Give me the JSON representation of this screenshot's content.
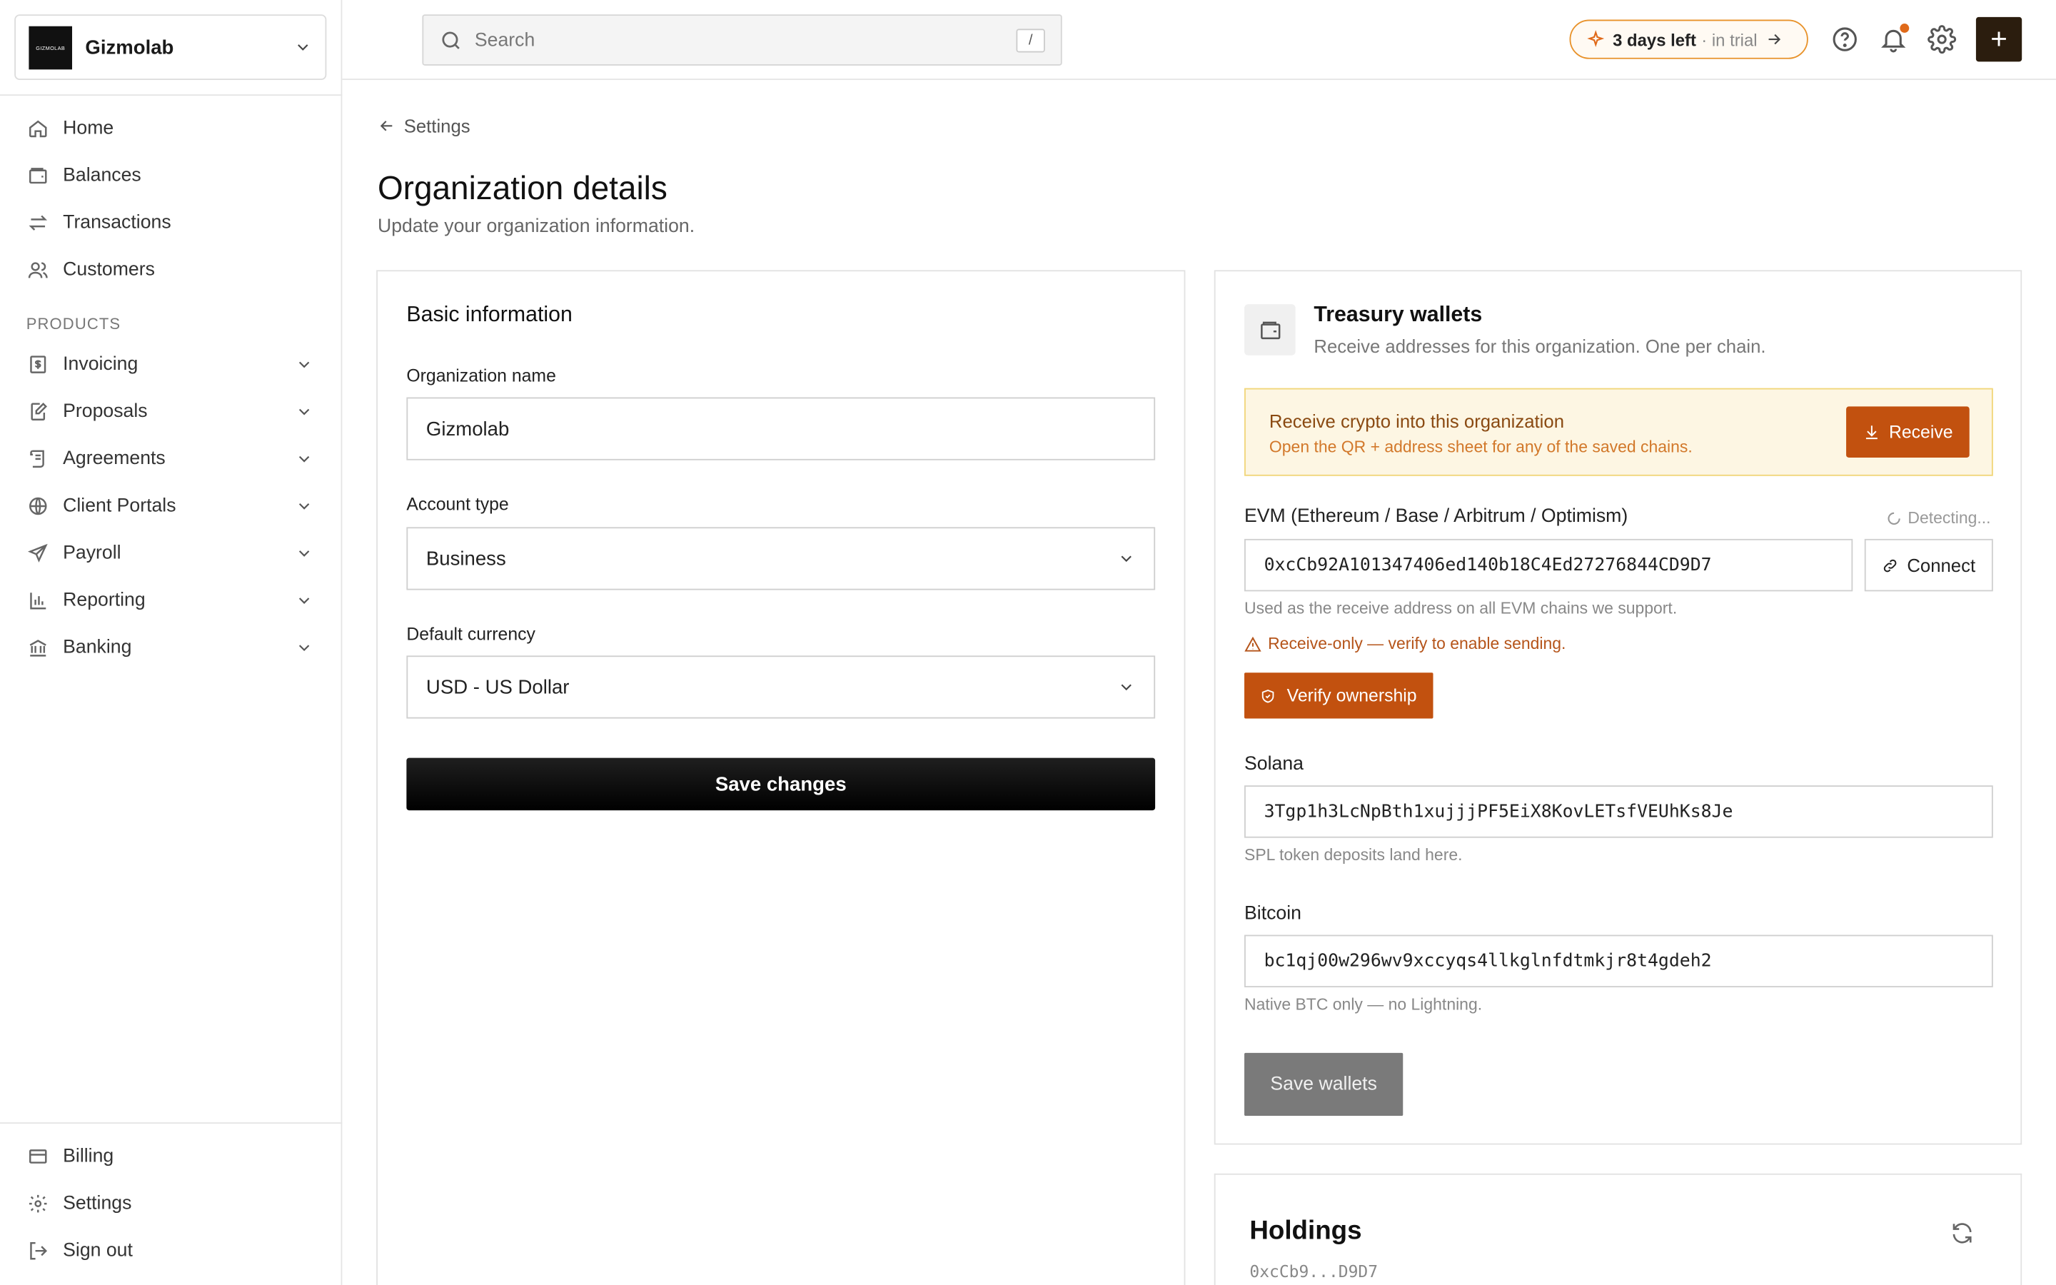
{
  "org": {
    "logo_text": "GIZMOLAB",
    "name": "Gizmolab"
  },
  "sidebar": {
    "main_items": [
      {
        "label": "Home",
        "icon": "home-icon"
      },
      {
        "label": "Balances",
        "icon": "wallet-icon"
      },
      {
        "label": "Transactions",
        "icon": "arrows-icon"
      },
      {
        "label": "Customers",
        "icon": "users-icon"
      }
    ],
    "section_label": "PRODUCTS",
    "product_items": [
      {
        "label": "Invoicing",
        "icon": "dollar-doc-icon"
      },
      {
        "label": "Proposals",
        "icon": "edit-doc-icon"
      },
      {
        "label": "Agreements",
        "icon": "scroll-icon"
      },
      {
        "label": "Client Portals",
        "icon": "globe-icon"
      },
      {
        "label": "Payroll",
        "icon": "send-icon"
      },
      {
        "label": "Reporting",
        "icon": "bar-chart-icon"
      },
      {
        "label": "Banking",
        "icon": "bank-icon"
      }
    ],
    "footer_items": [
      {
        "label": "Billing",
        "icon": "card-icon"
      },
      {
        "label": "Settings",
        "icon": "gear-icon"
      },
      {
        "label": "Sign out",
        "icon": "logout-icon"
      }
    ]
  },
  "topbar": {
    "search_placeholder": "Search",
    "search_shortcut": "/",
    "trial_strong": "3 days left",
    "trial_light": "· in trial",
    "plus_label": "+"
  },
  "page": {
    "back_label": "Settings",
    "title": "Organization details",
    "subtitle": "Update your organization information."
  },
  "basic": {
    "title": "Basic information",
    "org_name_label": "Organization name",
    "org_name_value": "Gizmolab",
    "account_type_label": "Account type",
    "account_type_value": "Business",
    "currency_label": "Default currency",
    "currency_value": "USD - US Dollar",
    "save_label": "Save changes"
  },
  "wallets": {
    "title": "Treasury wallets",
    "subtitle": "Receive addresses for this organization. One per chain.",
    "receive_title": "Receive crypto into this organization",
    "receive_sub": "Open the QR + address sheet for any of the saved chains.",
    "receive_btn": "Receive",
    "evm_label": "EVM (Ethereum / Base / Arbitrum / Optimism)",
    "detecting": "Detecting...",
    "evm_address": "0xcCb92A101347406ed140b18C4Ed27276844CD9D7",
    "connect_label": "Connect",
    "evm_hint": "Used as the receive address on all EVM chains we support.",
    "warn_text": "Receive-only — verify to enable sending.",
    "verify_label": "Verify ownership",
    "solana_label": "Solana",
    "solana_address": "3Tgp1h3LcNpBth1xujjjPF5EiX8KovLETsfVEUhKs8Je",
    "solana_hint": "SPL token deposits land here.",
    "bitcoin_label": "Bitcoin",
    "bitcoin_address": "bc1qj00w296wv9xccyqs4llkglnfdtmkjr8t4gdeh2",
    "bitcoin_hint": "Native BTC only — no Lightning.",
    "save_label": "Save wallets"
  },
  "holdings": {
    "title": "Holdings",
    "address": "0xcCb9...D9D7"
  },
  "colors": {
    "accent": "#c2510f",
    "trial_border": "#e8922a",
    "receive_bg": "#fdf6e3",
    "dark_button": "#2b1d0e"
  }
}
